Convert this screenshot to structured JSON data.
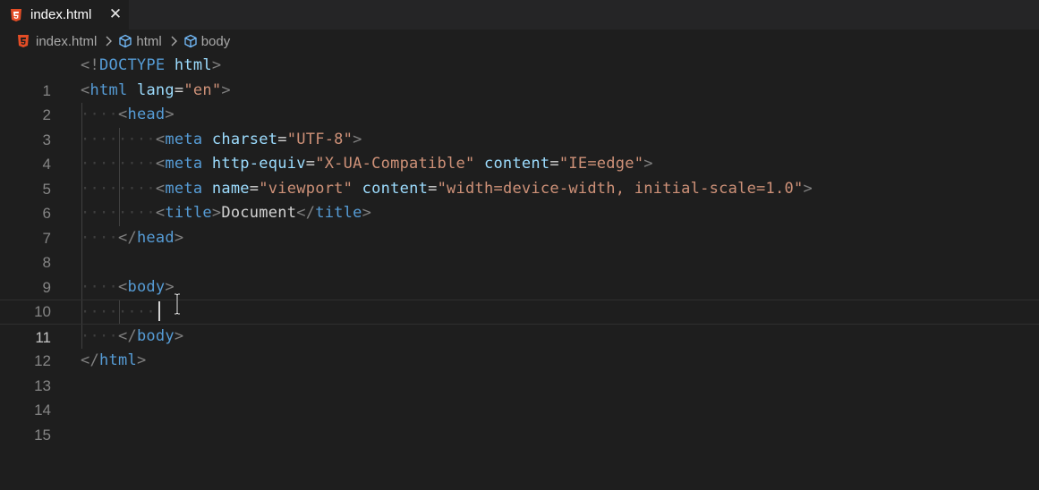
{
  "tab": {
    "filename": "index.html",
    "close_glyph": "✕",
    "icon": "html5-icon"
  },
  "breadcrumb": {
    "file": "index.html",
    "items": [
      "html",
      "body"
    ],
    "separator_icon": "chevron-right-icon",
    "symbol_icon": "cube-icon"
  },
  "editor": {
    "line_numbers": [
      "1",
      "2",
      "3",
      "4",
      "5",
      "6",
      "7",
      "8",
      "9",
      "10",
      "11",
      "12",
      "13",
      "14",
      "15"
    ],
    "current_line": "11",
    "code": {
      "l1": {
        "a": "<!",
        "b": "DOCTYPE",
        "c": " ",
        "d": "html",
        "e": ">"
      },
      "l2": {
        "a": "<",
        "b": "html",
        "c": " ",
        "d": "lang",
        "e": "=",
        "f": "\"en\"",
        "g": ">"
      },
      "l3": {
        "a": "<",
        "b": "head",
        "c": ">"
      },
      "l4": {
        "a": "<",
        "b": "meta",
        "c": " ",
        "d": "charset",
        "e": "=",
        "f": "\"UTF-8\"",
        "g": ">"
      },
      "l5": {
        "a": "<",
        "b": "meta",
        "c": " ",
        "d": "http-equiv",
        "e": "=",
        "f": "\"X-UA-Compatible\"",
        "g": " ",
        "h": "content",
        "i": "=",
        "j": "\"IE=edge\"",
        "k": ">"
      },
      "l6": {
        "a": "<",
        "b": "meta",
        "c": " ",
        "d": "name",
        "e": "=",
        "f": "\"viewport\"",
        "g": " ",
        "h": "content",
        "i": "=",
        "j": "\"width=device-width, initial-scale=1.0\"",
        "k": ">"
      },
      "l7": {
        "a": "<",
        "b": "title",
        "c": ">",
        "d": "Document",
        "e": "</",
        "f": "title",
        "g": ">"
      },
      "l8": {
        "a": "</",
        "b": "head",
        "c": ">"
      },
      "l10": {
        "a": "<",
        "b": "body",
        "c": ">"
      },
      "l12": {
        "a": "</",
        "b": "body",
        "c": ">"
      },
      "l13": {
        "a": "</",
        "b": "html",
        "c": ">"
      }
    }
  },
  "colors": {
    "background": "#1e1e1e",
    "tag": "#569cd6",
    "attribute": "#9cdcfe",
    "string": "#ce9178",
    "punctuation": "#808080",
    "html5_orange": "#e44d26"
  }
}
